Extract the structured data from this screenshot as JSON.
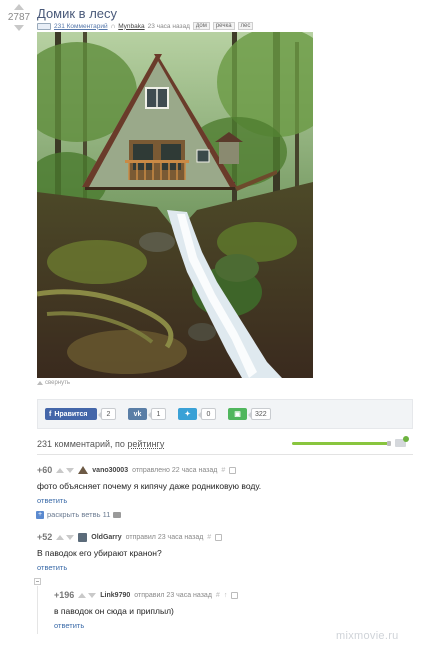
{
  "post": {
    "rating": "2787",
    "title": "Домик в лесу",
    "comments_link": "231 Комментарий",
    "author": "Mynbaka",
    "time": "23 часа назад",
    "tags": [
      "дом",
      "речка",
      "лес"
    ],
    "collapse_label": "свернуть"
  },
  "share": {
    "like_label": "Нравится",
    "fb_count": "2",
    "vk_count": "1",
    "tw_count": "0",
    "save_count": "322",
    "vk_icon": "vk-icon",
    "tw_icon": "twitter-bird-icon",
    "save_icon": "floppy-icon"
  },
  "comments_header": {
    "count_text": "231 комментарий, по ",
    "sort_label": "рейтингу"
  },
  "comments": [
    {
      "score": "+60",
      "user": "vano30003",
      "action": "отправлено 22 часа назад",
      "hash": "#",
      "text": "фото объясняет почему я кипячу даже родниковую воду.",
      "reply": "ответить",
      "expand": "раскрыть ветвь 11"
    },
    {
      "score": "+52",
      "user": "OldGarry",
      "action": "отправил 23 часа назад",
      "hash": "#",
      "text": "В паводок его убирают кранон?",
      "reply": "ответить"
    },
    {
      "score": "+196",
      "user": "Link9790",
      "action": "отправил 23 часа назад",
      "hash": "#",
      "extra": "↑",
      "text": "в паводок он сюда и приплыл)",
      "reply": "ответить"
    }
  ],
  "watermark": "mixmovie.ru",
  "colors": {
    "link": "#3a6aa8",
    "fb": "#4466a9",
    "vk": "#5a7ea6",
    "twitter": "#3aa1d6",
    "save": "#50b65d",
    "progress": "#89c53e"
  }
}
